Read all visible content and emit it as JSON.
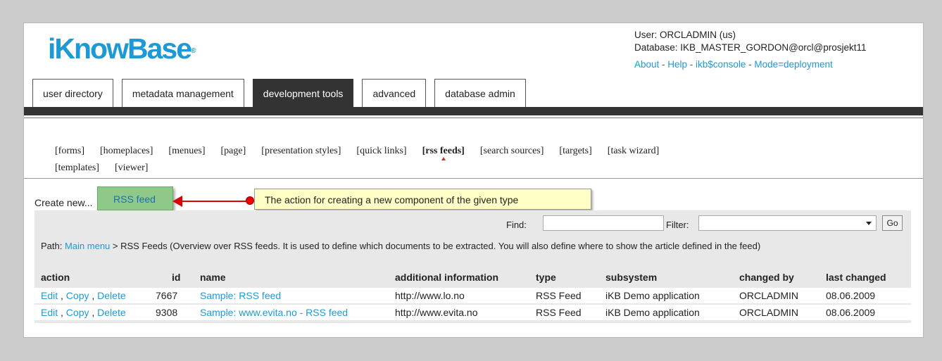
{
  "logo": {
    "text": "iKnowBase",
    "mark": "®"
  },
  "user": {
    "line1": "User: ORCLADMIN (us)",
    "line2": "Database: IKB_MASTER_GORDON@orcl@prosjekt11",
    "links": [
      "About",
      "Help",
      "ikb$console",
      "Mode=deployment"
    ]
  },
  "tabs": [
    "user directory",
    "metadata management",
    "development tools",
    "advanced",
    "database admin"
  ],
  "submenu": [
    "[forms]",
    "[homeplaces]",
    "[menues]",
    "[page]",
    "[presentation styles]",
    "[quick links]",
    "[rss feeds]",
    "[search sources]",
    "[targets]",
    "[task wizard]",
    "[templates]",
    "[viewer]"
  ],
  "create": {
    "label": "Create new...",
    "button": "RSS feed"
  },
  "tooltip": "The action for creating a new component of the given type",
  "search": {
    "find_label": "Find:",
    "filter_label": "Filter:",
    "go_label": "Go"
  },
  "path": {
    "prefix": "Path: ",
    "link": "Main menu",
    "rest": " > RSS Feeds (Overview over RSS feeds. It is used to define which documents to be extracted. You will also define where to show the article defined in the feed)"
  },
  "table": {
    "headers": [
      "action",
      "id",
      "name",
      "additional information",
      "type",
      "subsystem",
      "changed by",
      "last changed"
    ],
    "rows": [
      {
        "edit": "Edit",
        "copy": "Copy",
        "delete": "Delete",
        "id": "7667",
        "name": "Sample: RSS feed",
        "info": "http://www.lo.no",
        "type": "RSS Feed",
        "subsystem": "iKB Demo application",
        "changed_by": "ORCLADMIN",
        "last_changed": "08.06.2009"
      },
      {
        "edit": "Edit",
        "copy": "Copy",
        "delete": "Delete",
        "id": "9308",
        "name": "Sample: www.evita.no - RSS feed",
        "info": "http://www.evita.no",
        "type": "RSS Feed",
        "subsystem": "iKB Demo application",
        "changed_by": "ORCLADMIN",
        "last_changed": "08.06.2009"
      }
    ]
  }
}
